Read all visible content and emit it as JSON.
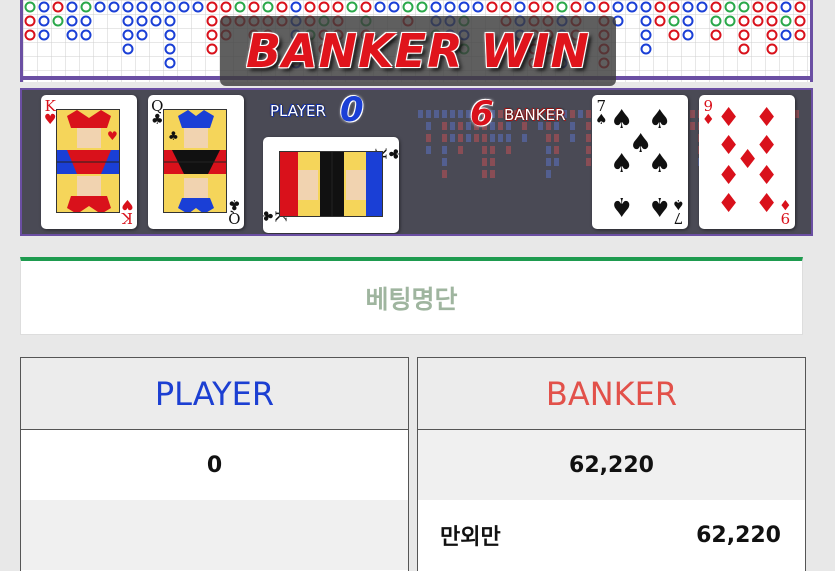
{
  "banner": {
    "text": "BANKER WIN"
  },
  "table": {
    "player_label": "PLAYER",
    "player_score": "0",
    "banker_label": "BANKER",
    "banker_score": "6"
  },
  "cards": [
    {
      "rank": "K",
      "suit": "♥",
      "color": "red",
      "owner": "player"
    },
    {
      "rank": "Q",
      "suit": "♣",
      "color": "black",
      "owner": "player"
    },
    {
      "rank": "K",
      "suit": "♣",
      "color": "black",
      "owner": "player",
      "rotated": true
    },
    {
      "rank": "7",
      "suit": "♠",
      "color": "black",
      "owner": "banker"
    },
    {
      "rank": "9",
      "suit": "♦",
      "color": "red",
      "owner": "banker"
    }
  ],
  "betting": {
    "title": "베팅명단",
    "player": {
      "header": "PLAYER",
      "total": "0"
    },
    "banker": {
      "header": "BANKER",
      "total": "62,220",
      "entry_name": "만외만",
      "entry_amount": "62,220"
    }
  },
  "colors": {
    "player": "#1c3fd2",
    "banker": "#e2514a",
    "accent": "#1e9b4f",
    "frame": "#6b4fa3"
  }
}
